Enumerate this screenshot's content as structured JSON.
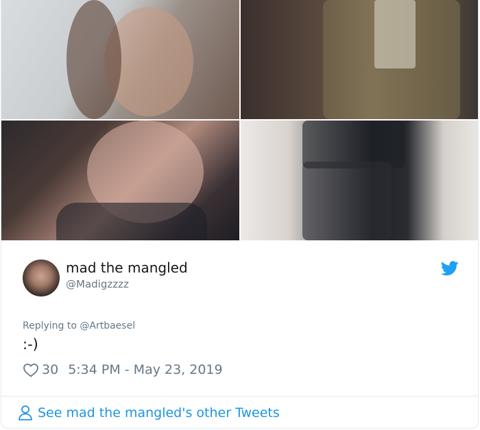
{
  "media": {
    "photos": [
      {
        "icon": "photo-selfie-hood"
      },
      {
        "icon": "photo-jacket-outfit"
      },
      {
        "icon": "photo-selfie-turtleneck"
      },
      {
        "icon": "photo-floral-skirt"
      }
    ]
  },
  "author": {
    "name": "mad the mangled",
    "handle": "@Madigzzzz",
    "avatar_icon": "avatar-image"
  },
  "brand": {
    "icon": "twitter-bird-icon",
    "color": "#1da1f2"
  },
  "tweet": {
    "replying_prefix": "Replying to ",
    "replying_to": "@Artbaesel",
    "text": ":-)"
  },
  "meta": {
    "likes": "30",
    "timestamp": "5:34 PM - May 23, 2019"
  },
  "footer": {
    "link_text": "See mad the mangled's other Tweets",
    "link_color": "#1b95e0"
  }
}
